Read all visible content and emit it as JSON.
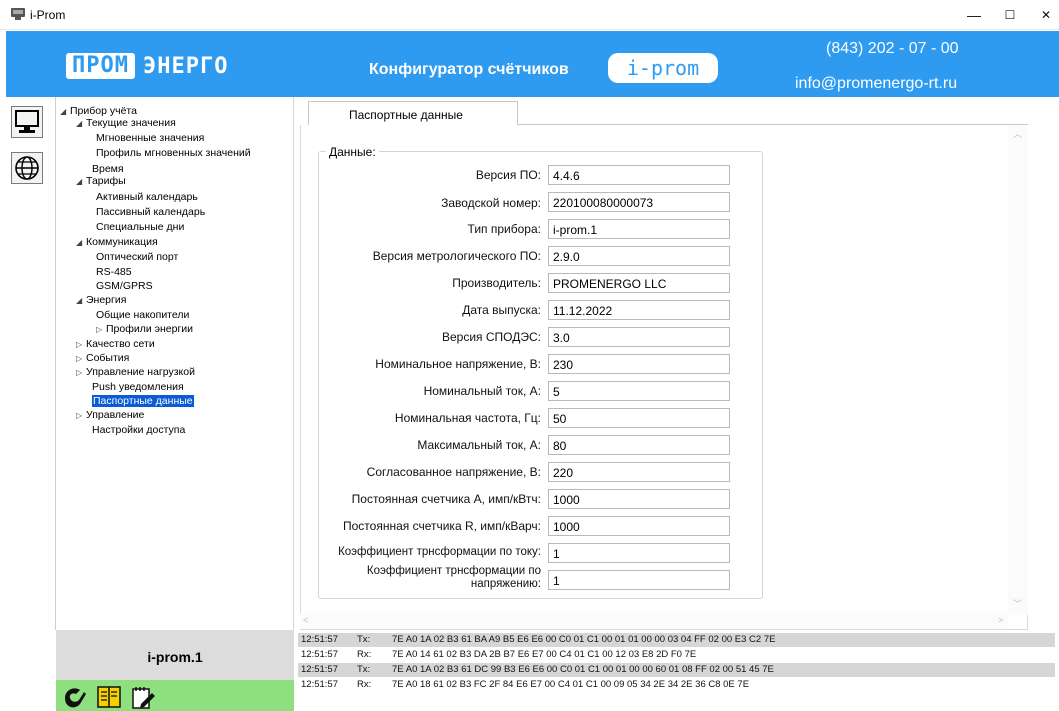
{
  "window": {
    "title": "i-Prom",
    "minimize": "—",
    "maximize": "☐",
    "close": "✕"
  },
  "banner": {
    "logo_box": "ПРОМ",
    "logo_rest": "ЭНЕРГО",
    "config_title": "Конфигуратор счётчиков",
    "badge": "i-prom",
    "phone": "(843) 202 - 07 - 00",
    "email": "info@promenergo-rt.ru",
    "color": "#2e9bf0"
  },
  "rail": {
    "icons": [
      "computer-icon",
      "globe-icon"
    ]
  },
  "tree": {
    "items": [
      {
        "label": "Прибор учёта",
        "arrow": "◢"
      },
      {
        "label": "Текущие значения",
        "arrow": "◢"
      },
      {
        "label": "Мгновенные значения",
        "arrow": ""
      },
      {
        "label": "Профиль мгновенных значений",
        "arrow": ""
      },
      {
        "label": "Время",
        "arrow": ""
      },
      {
        "label": "Тарифы",
        "arrow": "◢"
      },
      {
        "label": "Активный календарь",
        "arrow": ""
      },
      {
        "label": "Пассивный календарь",
        "arrow": ""
      },
      {
        "label": "Специальные дни",
        "arrow": ""
      },
      {
        "label": "Коммуникация",
        "arrow": "◢"
      },
      {
        "label": "Оптический порт",
        "arrow": ""
      },
      {
        "label": "RS-485",
        "arrow": ""
      },
      {
        "label": "GSM/GPRS",
        "arrow": ""
      },
      {
        "label": "Энергия",
        "arrow": "◢"
      },
      {
        "label": "Общие накопители",
        "arrow": ""
      },
      {
        "label": "Профили энергии",
        "arrow": "▷"
      },
      {
        "label": "Качество сети",
        "arrow": "▷"
      },
      {
        "label": "События",
        "arrow": "▷"
      },
      {
        "label": "Управление нагрузкой",
        "arrow": "▷"
      },
      {
        "label": "Push уведомления",
        "arrow": ""
      },
      {
        "label": "Паспортные данные",
        "arrow": ""
      },
      {
        "label": "Управление",
        "arrow": "▷"
      },
      {
        "label": "Настройки доступа",
        "arrow": ""
      }
    ],
    "selected": "Паспортные данные"
  },
  "tab": {
    "label": "Паспортные данные"
  },
  "group": {
    "title": "Данные:"
  },
  "fields": [
    {
      "label": "Версия ПО:",
      "value": "4.4.6"
    },
    {
      "label": "Заводской номер:",
      "value": "220100080000073"
    },
    {
      "label": "Тип прибора:",
      "value": "i-prom.1"
    },
    {
      "label": "Версия метрологического ПО:",
      "value": "2.9.0"
    },
    {
      "label": "Производитель:",
      "value": "PROMENERGO LLC"
    },
    {
      "label": "Дата выпуска:",
      "value": "11.12.2022"
    },
    {
      "label": "Версия СПОДЭС:",
      "value": "3.0"
    },
    {
      "label": "Номинальное напряжение, В:",
      "value": "230"
    },
    {
      "label": "Номинальный ток, А:",
      "value": "5"
    },
    {
      "label": "Номинальная частота, Гц:",
      "value": "50"
    },
    {
      "label": "Максимальный ток, А:",
      "value": "80"
    },
    {
      "label": "Согласованное напряжение, В:",
      "value": "220"
    },
    {
      "label": "Постоянная счетчика А, имп/кВтч:",
      "value": "1000"
    },
    {
      "label": "Постоянная счетчика R, имп/кВарч:",
      "value": "1000"
    },
    {
      "label": "Коэффициент трнсформации по току:",
      "value": "1"
    },
    {
      "label": "Коэффициент трнсформации по напряжению:",
      "value": "1"
    }
  ],
  "device": {
    "name": "i-prom.1"
  },
  "log": [
    {
      "time": "12:51:57",
      "dir": "Tx:",
      "hex": "7E A0 1A 02 B3 61 BA A9 B5 E6 E6 00 C0 01 C1 00 01 01 00 00 03 04 FF 02 00 E3 C2 7E"
    },
    {
      "time": "12:51:57",
      "dir": "Rx:",
      "hex": "7E A0 14 61 02 B3 DA 2B B7 E6 E7 00 C4 01 C1 00 12 03 E8 2D F0 7E"
    },
    {
      "time": "12:51:57",
      "dir": "Tx:",
      "hex": "7E A0 1A 02 B3 61 DC 99 B3 E6 E6 00 C0 01 C1 00 01 00 00 60 01 08 FF 02 00 51 45 7E"
    },
    {
      "time": "12:51:57",
      "dir": "Rx:",
      "hex": "7E A0 18 61 02 B3 FC 2F 84 E6 E7 00 C4 01 C1 00 09 05 34 2E 34 2E 36 C8 0E 7E"
    }
  ]
}
